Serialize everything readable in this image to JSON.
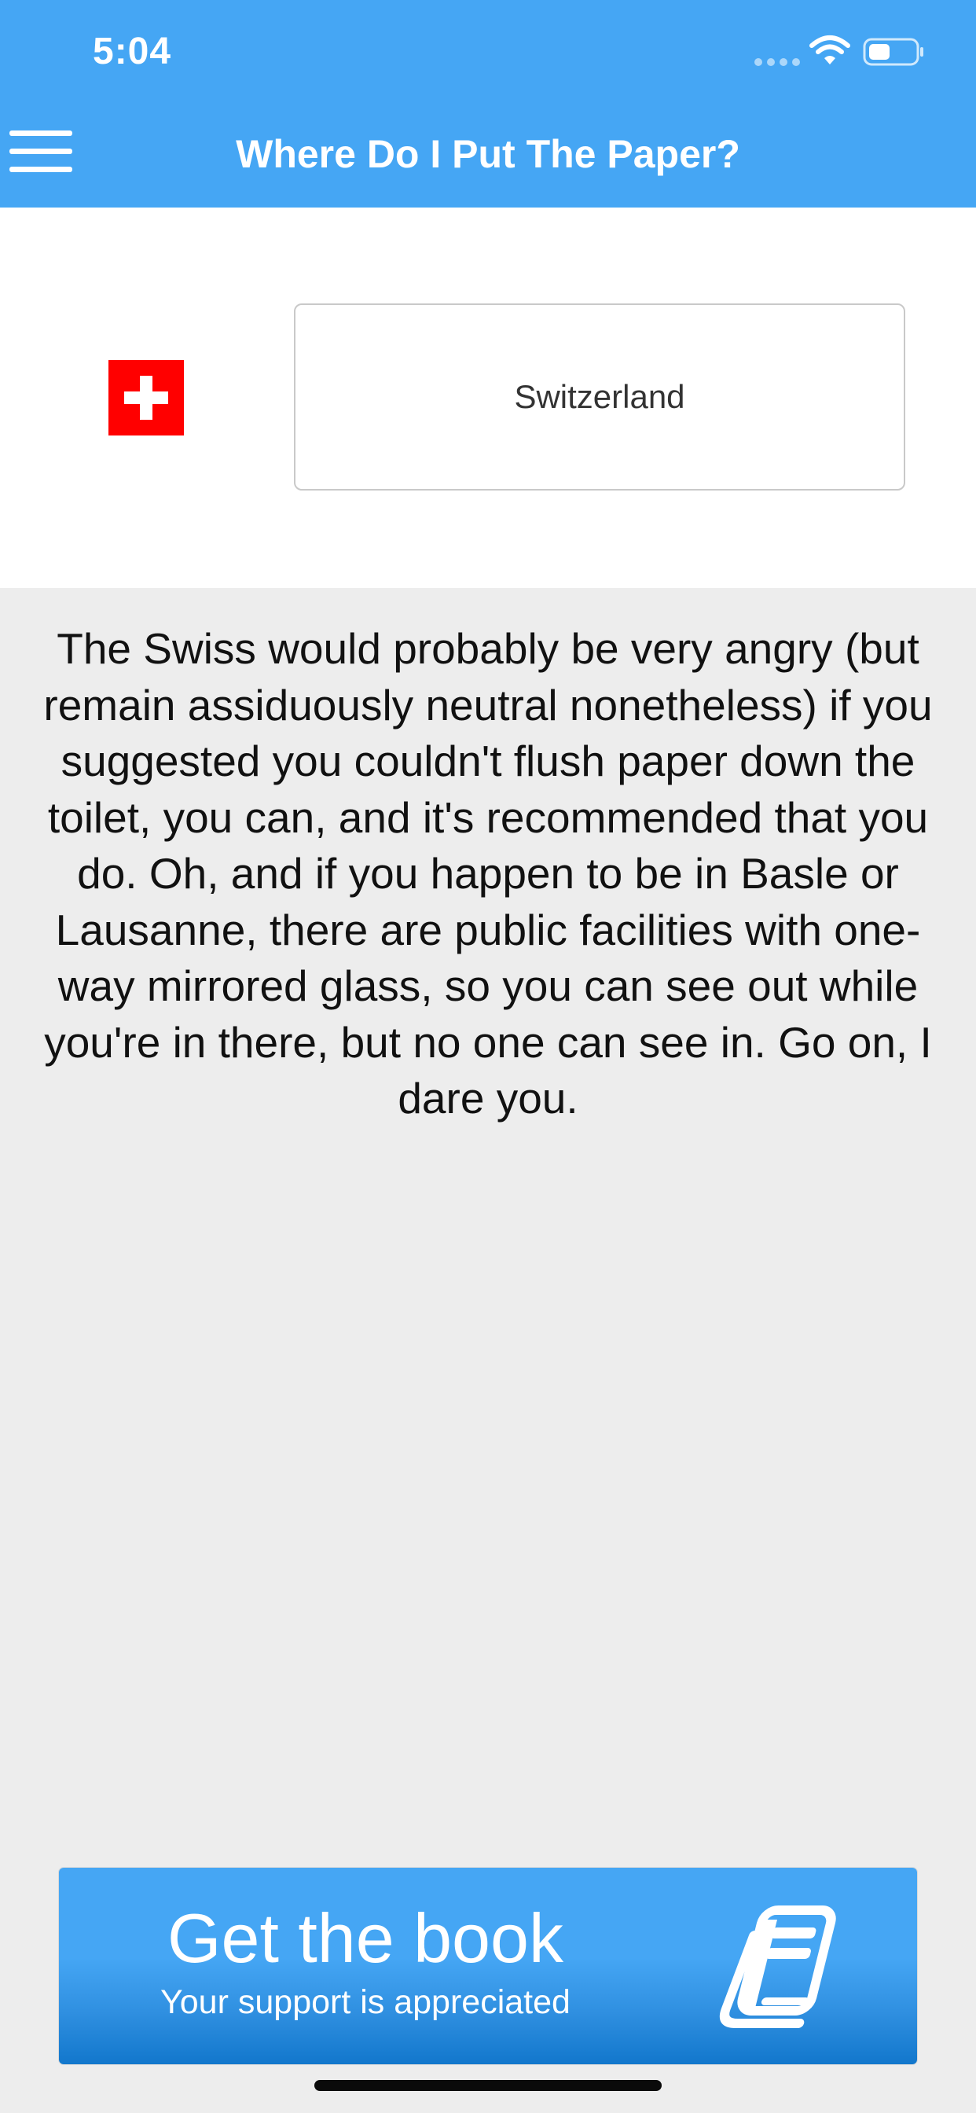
{
  "status_bar": {
    "time": "5:04",
    "icons": [
      "cellular-signal-icon",
      "wifi-icon",
      "battery-icon"
    ]
  },
  "header": {
    "menu_icon": "hamburger-menu-icon",
    "title": "Where Do I Put The Paper?"
  },
  "country": {
    "flag_icon": "switzerland-flag-icon",
    "selected": "Switzerland"
  },
  "description": "The Swiss would probably be very angry (but remain assiduously neutral nonetheless) if you suggested you couldn't flush paper down the toilet, you can, and it's recommended that you do. Oh, and if you happen to be in Basle or Lausanne, there are public facilities with one-way mirrored glass, so you can see out while you're in there, but no one can see in. Go on, I dare you.",
  "promo": {
    "title": "Get the book",
    "subtitle": "Your support is appreciated",
    "icon": "book-icon"
  },
  "colors": {
    "header": "#45a6f4",
    "page_background": "#ededed",
    "flag_red": "#ff0000",
    "button_bottom": "#1277cc"
  }
}
